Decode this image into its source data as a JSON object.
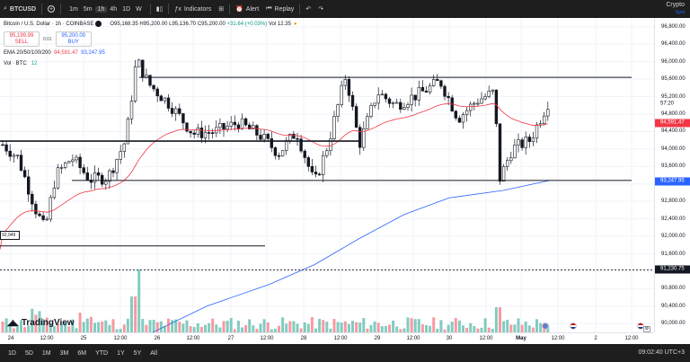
{
  "topbar": {
    "symbol": "BTCUSD",
    "add": "+",
    "timeframes": [
      "1m",
      "5m",
      "1h",
      "4h",
      "1D",
      "W"
    ],
    "active_tf": "1h",
    "indicators_label": "Indicators",
    "alert_label": "Alert",
    "replay_label": "Replay",
    "crypto_label": "Crypto",
    "crypto_sub": "Spot"
  },
  "legend": {
    "title": "Bitcoin / U.S. Dollar · 1h · COINBASE",
    "open": "O95,168.35",
    "high": "H95,200.00",
    "low": "L95,136.70",
    "close": "C95,200.00",
    "change": "+31.64 (+0.03%)",
    "vol": "Vol 12.35"
  },
  "trade": {
    "sell_price": "95,199.99",
    "sell_label": "SELL",
    "spread": "0.01",
    "buy_price": "95,200.00",
    "buy_label": "BUY"
  },
  "ema": {
    "label": "EMA 20/50/100/200",
    "v1": "94,591.47",
    "v2": "93,247.95"
  },
  "volume": {
    "label": "Vol · BTC",
    "value": "12"
  },
  "left_label": "92,949",
  "logo_text": "TradingView",
  "y_ticks": [
    "96,800.00",
    "96,400.00",
    "96,000.00",
    "95,600.00",
    "95,200.00",
    "94,800.00",
    "94,400.00",
    "94,000.00",
    "93,600.00",
    "93,200.00",
    "92,800.00",
    "92,400.00",
    "92,000.00",
    "91,600.00",
    "91,200.00",
    "90,800.00",
    "90,400.00",
    "90,000.00"
  ],
  "y_tags": {
    "countdown": "57:20",
    "ema20": "94,591.47",
    "ema50": "93,247.95",
    "line": "91,230.75"
  },
  "x_ticks": [
    "24",
    "12:00",
    "25",
    "12:00",
    "26",
    "12:00",
    "27",
    "12:00",
    "28",
    "12:00",
    "29",
    "12:00",
    "30",
    "12:00",
    "May",
    "12:00",
    "2",
    "12:00"
  ],
  "bottombar": {
    "ranges": [
      "1D",
      "5D",
      "1M",
      "3M",
      "6M",
      "YTD",
      "1Y",
      "5Y",
      "All"
    ],
    "clock": "09:02:40 UTC+3"
  },
  "colors": {
    "up": "#089981",
    "down": "#f23645",
    "ema_red": "#f23645",
    "ema_blue": "#2962ff"
  },
  "chart_data": {
    "type": "candlestick",
    "ylim": [
      89800,
      97000
    ],
    "price_levels": [
      95640,
      94180,
      93280,
      91780,
      91230.75
    ]
  }
}
